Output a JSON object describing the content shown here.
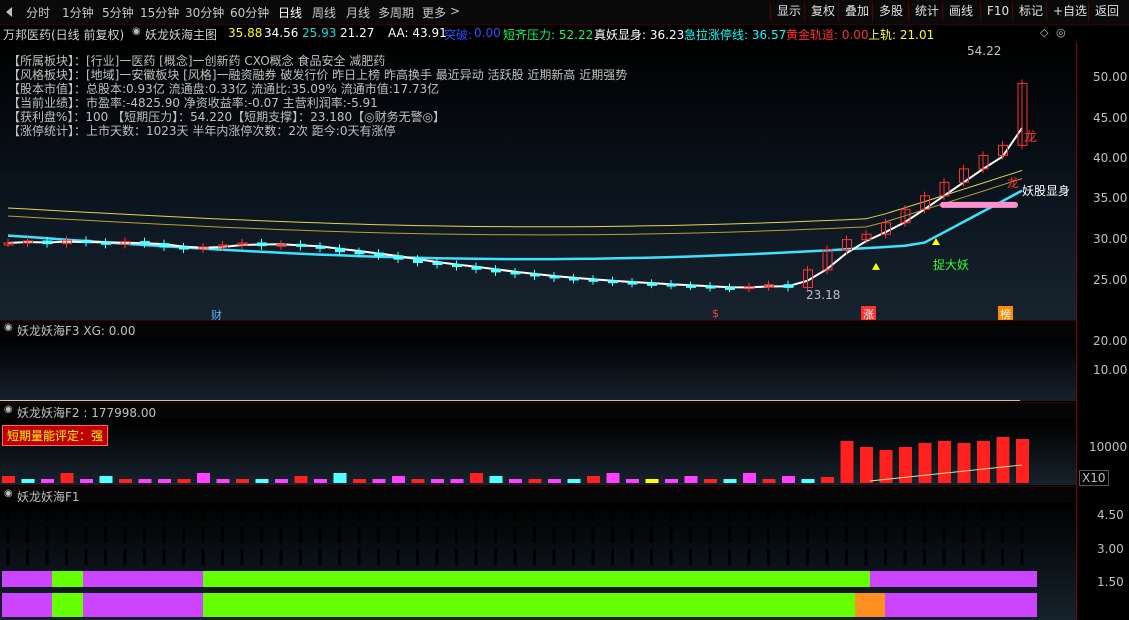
{
  "toolbar": {
    "periods": [
      "分时",
      "1分钟",
      "5分钟",
      "15分钟",
      "30分钟",
      "60分钟",
      "日线",
      "周线",
      "月线",
      "多周期",
      "更多"
    ],
    "active_period": "日线",
    "right_buttons": [
      "显示",
      "复权",
      "叠加",
      "多股",
      "统计",
      "画线",
      "F10",
      "标记",
      "+自选",
      "返回"
    ]
  },
  "info": {
    "stock": "万邦医药(日线 前复权)",
    "formula": "妖龙妖海主图",
    "v1": "35.88",
    "v2": "34.56",
    "v3": "25.93",
    "v4": "21.27",
    "aa": "AA: 43.91",
    "breakout_label": "突破:",
    "breakout_val": "0.00",
    "short_press": "短齐压力: 52.22",
    "true_monster": "真妖显身: 36.23",
    "limit_line": "急拉涨停线: 36.57",
    "gold_track": "黄金轨道: 0.00",
    "upper_track": "上轨: 21.01"
  },
  "annotations": [
    {
      "text": "【所属板块】：[行业]一医药 [概念]一创新药 CXO概念 食品安全 减肥药",
      "color": "#ffff00"
    },
    {
      "text": "【风格板块】：[地域]一安徽板块 [风格]一融资融券 破发行价 昨日上榜 昨高换手 最近异动 活跃股 近期新高 近期强势",
      "color": "#ffff00"
    },
    {
      "text": "【股本市值】：总股本:0.93亿 流通盘:0.33亿 流通比:35.09% 流通市值:17.73亿",
      "color": "#ff40ff"
    },
    {
      "text": "【当前业绩】：市盈率:-4825.90 净资收益率:-0.07 主营利润率:-5.91",
      "color": "#ff40ff"
    },
    {
      "text": "【获利盘%】：100   【短期压力】：54.220【短期支撑】：23.180【◎财务无警◎】",
      "color": "#00ff00"
    },
    {
      "text": "【涨停统计】：上市天数：1023天 半年内涨停次数：2次   距今:0天有涨停",
      "color": "#ffff00"
    }
  ],
  "main_chart": {
    "y_ticks": [
      "50.00",
      "45.00",
      "40.00",
      "35.00",
      "30.00",
      "25.00"
    ],
    "high_label": "54.22",
    "low_label": "23.18",
    "dragon1": "龙",
    "dragon2": "龙",
    "monster_label": "妖股显身",
    "catch_label": "捉大妖",
    "markers": [
      "财",
      "$",
      "涨",
      "榜"
    ]
  },
  "chart_data": {
    "type": "candlestick",
    "y_axis_ticks": [
      25,
      30,
      35,
      40,
      45,
      50
    ],
    "close_series": [
      30.5,
      30.8,
      30.4,
      30.9,
      30.6,
      30.3,
      30.7,
      30.4,
      29.9,
      29.6,
      29.9,
      30.2,
      30.5,
      30.1,
      30.3,
      30.0,
      29.7,
      29.2,
      29.0,
      28.6,
      28.1,
      27.6,
      27.3,
      27.0,
      26.6,
      26.2,
      25.9,
      25.6,
      25.3,
      25.1,
      24.9,
      24.7,
      24.5,
      24.4,
      24.2,
      24.1,
      23.9,
      23.8,
      24.0,
      24.3,
      23.9,
      26.5,
      29.5,
      31.0,
      31.8,
      33.5,
      35.5,
      37.5,
      39.5,
      41.5,
      43.5,
      45.0,
      54.2
    ],
    "price_high": 54.22,
    "price_low": 23.18
  },
  "f3": {
    "title": "妖龙妖海F3 XG: 0.00",
    "y_ticks": [
      "20.00",
      "10.00"
    ]
  },
  "f2": {
    "title": "妖龙妖海F2 : 177998.00",
    "badge": "短期量能评定：强",
    "y_tick": "10000",
    "unit": "X10"
  },
  "f1": {
    "title": "妖龙妖海F1",
    "y_ticks": [
      "4.50",
      "3.00",
      "1.50"
    ]
  },
  "colors": {
    "up": "#ff3232",
    "down": "#54ffff",
    "ma_white": "#ffffff",
    "ma_cyan": "#40e0ff",
    "ma_yellow": "#ffff00"
  }
}
